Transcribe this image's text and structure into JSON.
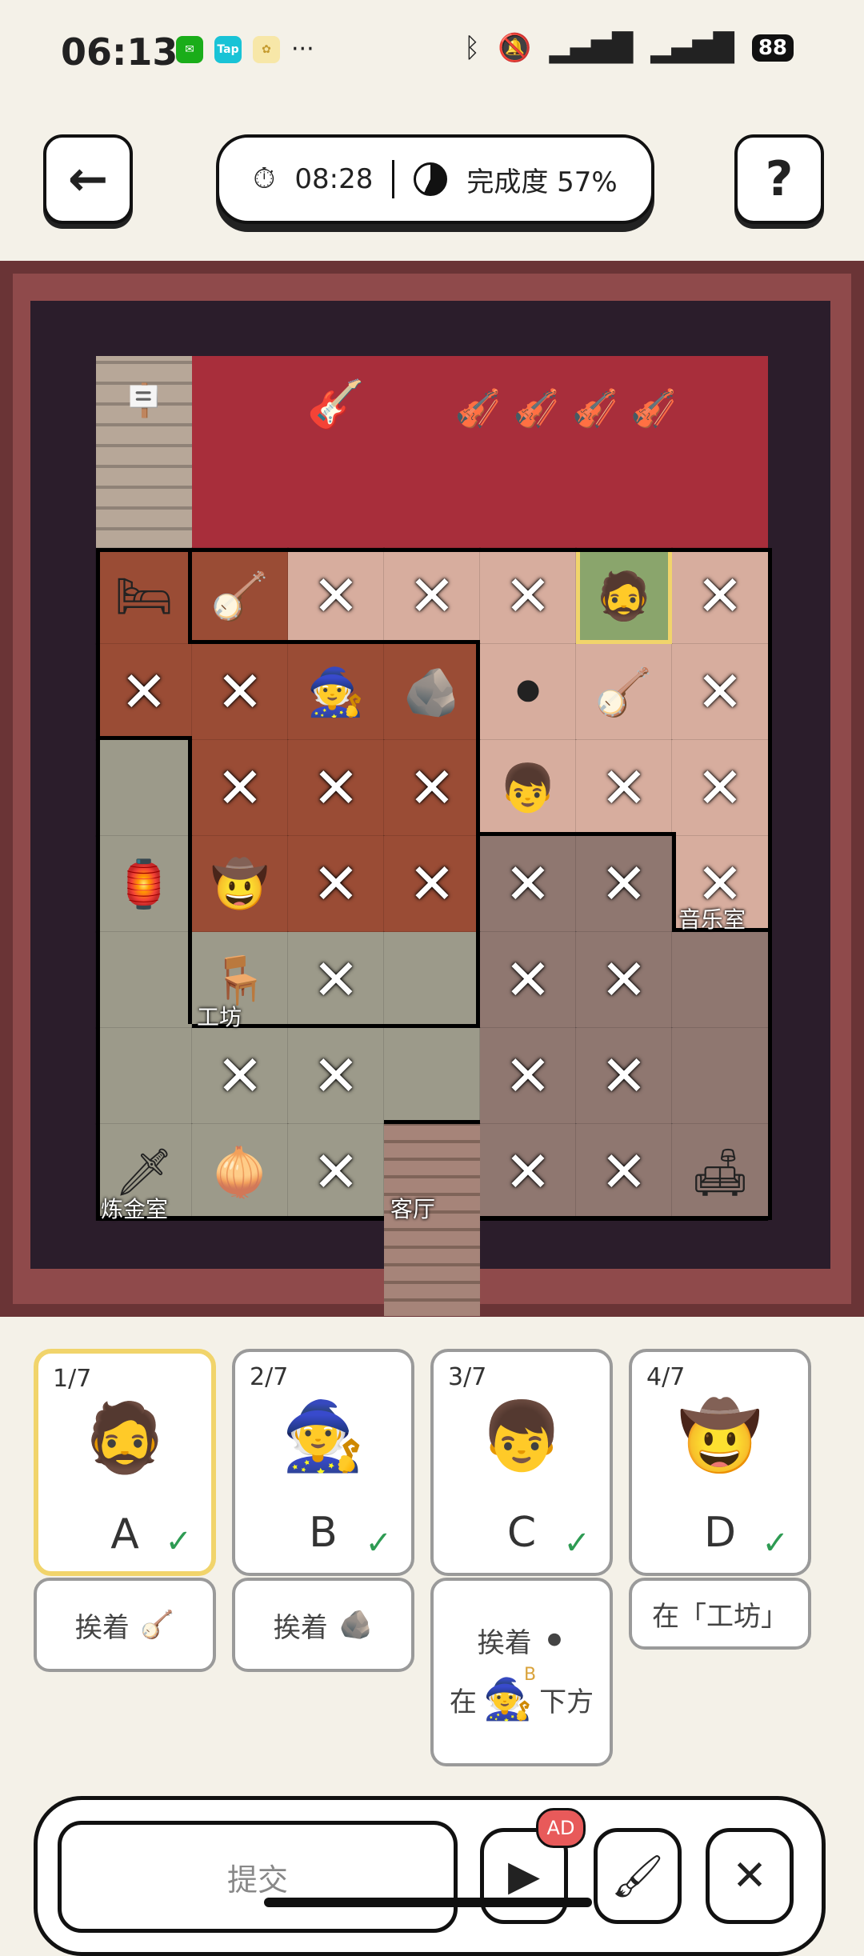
{
  "status": {
    "time": "06:13",
    "battery": "88",
    "apps": [
      "wechat-icon",
      "tap-icon",
      "rabbit-icon"
    ],
    "more": "···"
  },
  "header": {
    "timer": "08:28",
    "progress_label": "完成度 57%",
    "progress_value": 57
  },
  "rooms": {
    "alchemy": "炼金室",
    "workshop": "工坊",
    "living": "客厅",
    "music": "音乐室"
  },
  "suspects": [
    {
      "index": "1/7",
      "letter": "A",
      "check": "✓",
      "face": "🧔",
      "clue": "挨着",
      "clue_icon": "🪕",
      "selected": true
    },
    {
      "index": "2/7",
      "letter": "B",
      "check": "✓",
      "face": "🧙",
      "clue": "挨着",
      "clue_icon": "🪨"
    },
    {
      "index": "3/7",
      "letter": "C",
      "check": "✓",
      "face": "👦",
      "clue": "挨着",
      "clue_icon": "⚫",
      "clue2_prefix": "在",
      "clue2_tag": "B",
      "clue2_suffix": "下方"
    },
    {
      "index": "4/7",
      "letter": "D",
      "check": "✓",
      "face": "🤠",
      "clue": "在「工坊」"
    }
  ],
  "actions": {
    "submit": "提交",
    "ad_badge": "AD"
  },
  "colors": {
    "accent_selected": "#f1d46b",
    "check": "#2e9b53",
    "frame": "#6a3436",
    "carpet": "#a82e3b"
  }
}
